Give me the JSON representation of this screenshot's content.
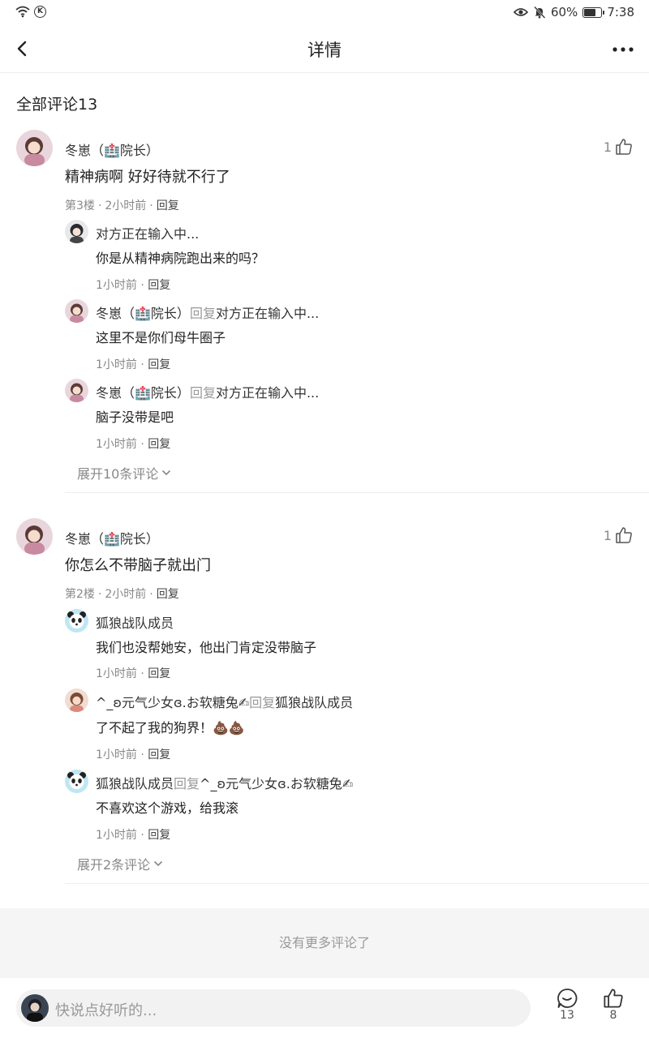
{
  "status": {
    "k_badge": "K",
    "battery": "60%",
    "battery_level": 0.6,
    "time": "7:38"
  },
  "header": {
    "title": "详情"
  },
  "section_title": "全部评论13",
  "comments": [
    {
      "username": "冬崽（🏥院长）",
      "like_count": "1",
      "content": "精神病啊 好好待就不行了",
      "floor": "第3楼",
      "time": "2小时前",
      "reply_label": "回复",
      "replies": [
        {
          "user": "对方正在输入中...",
          "content": "你是从精神病院跑出来的吗？",
          "time": "1小时前",
          "reply_label": "回复"
        },
        {
          "user": "冬崽（🏥院长）",
          "reply_word": "回复",
          "target": "对方正在输入中...",
          "content": "这里不是你们母牛圈子",
          "time": "1小时前",
          "reply_label": "回复"
        },
        {
          "user": "冬崽（🏥院长）",
          "reply_word": "回复",
          "target": "对方正在输入中...",
          "content": "脑子没带是吧",
          "time": "1小时前",
          "reply_label": "回复"
        }
      ],
      "expand": "展开10条评论"
    },
    {
      "username": "冬崽（🏥院长）",
      "like_count": "1",
      "content": "你怎么不带脑子就出门",
      "floor": "第2楼",
      "time": "2小时前",
      "reply_label": "回复",
      "replies": [
        {
          "user": "狐狼战队成员",
          "content": "我们也没帮她安，他出门肯定没带脑子",
          "time": "1小时前",
          "reply_label": "回复"
        },
        {
          "user": "^_ʚ元气少女ɞ.お软糖兔✍",
          "reply_word": "回复",
          "target": "狐狼战队成员",
          "content": "了不起了我的狗界！💩💩",
          "time": "1小时前",
          "reply_label": "回复"
        },
        {
          "user": "狐狼战队成员",
          "reply_word": "回复",
          "target": "^_ʚ元气少女ɞ.お软糖兔✍",
          "content": "不喜欢这个游戏，给我滚",
          "time": "1小时前",
          "reply_label": "回复"
        }
      ],
      "expand": "展开2条评论"
    }
  ],
  "no_more": "没有更多评论了",
  "bottom": {
    "placeholder": "快说点好听的...",
    "comment_count": "13",
    "like_count": "8"
  },
  "colors": {
    "accent_text": "#222222",
    "secondary_text": "#888888",
    "divider": "#eeeeee"
  }
}
